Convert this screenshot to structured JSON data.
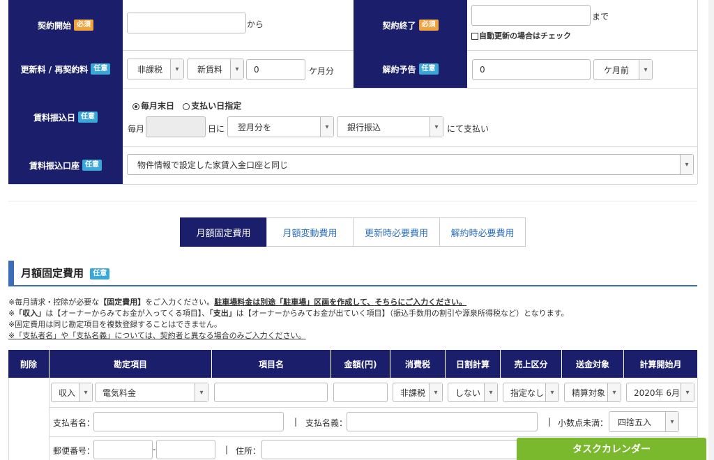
{
  "contract": {
    "start_label": "契約開始",
    "end_label": "契約終了",
    "badge_required": "必須",
    "badge_optional": "任意",
    "from_text": "から",
    "until_text": "まで",
    "auto_renew_text": "自動更新の場合はチェック",
    "renewal_label": "更新料 / 再契約料",
    "renewal_tax": "非課税",
    "renewal_type": "新賃料",
    "renewal_amount": "0",
    "months_unit": "ケ月分",
    "cancel_notice_label": "解約予告",
    "cancel_notice_value": "0",
    "cancel_notice_unit": "ケ月前",
    "rent_date_label": "賃料振込日",
    "radio_end_of_month": "毎月末日",
    "radio_specify_day": "支払い日指定",
    "monthly_prefix": "毎月",
    "day_suffix": "日に",
    "month_select": "翌月分を",
    "method_select": "銀行振込",
    "pay_suffix": "にて支払い",
    "account_label": "賃料振込口座",
    "account_select": "物件情報で設定した家賃入金口座と同じ"
  },
  "tabs": [
    "月額固定費用",
    "月額変動費用",
    "更新時必要費用",
    "解約時必要費用"
  ],
  "section": {
    "title": "月額固定費用",
    "badge": "任意",
    "note1_a": "※毎月請求・控除が必要な",
    "note1_b": "【固定費用】",
    "note1_c": "をご入力ください。",
    "note1_d": "駐車場料金は別途「駐車場」区画を作成して、そちらにご入力ください。",
    "note2_a": "※",
    "note2_b": "「収入」",
    "note2_c": "は【オーナーからみてお金が入ってくる項目】、",
    "note2_d": "「支出」",
    "note2_e": "は【オーナーからみてお金が出ていく項目】（振込手数用の割引や源泉所得税など）となります。",
    "note3": "※固定費用は同じ勘定項目を複数登録することはできません。",
    "note4": "※「支払者名」や「支払名義」については、契約者と異なる場合のみご入力ください。"
  },
  "table": {
    "headers": [
      "削除",
      "勘定項目",
      "項目名",
      "金額(円)",
      "消費税",
      "日割計算",
      "売上区分",
      "送金対象",
      "計算開始月"
    ],
    "row": {
      "io": "収入",
      "account": "電気料金",
      "tax": "非課税",
      "prorate": "しない",
      "sales": "指定なし",
      "transfer": "精算対象",
      "start_month": "2020年 6月"
    },
    "payer_label": "支払者名：",
    "payee_label": "支払名義：",
    "decimal_label": "小数点未満：",
    "decimal_value": "四捨五入",
    "postal_label": "郵便番号：",
    "address_label": "住所：",
    "sep": "|"
  },
  "task_calendar": "タスクカレンダー",
  "colors": {
    "navy": "#1b1e6b",
    "required": "#f0a33a",
    "optional": "#3aa7d9",
    "accent_green": "#7ab82d"
  }
}
